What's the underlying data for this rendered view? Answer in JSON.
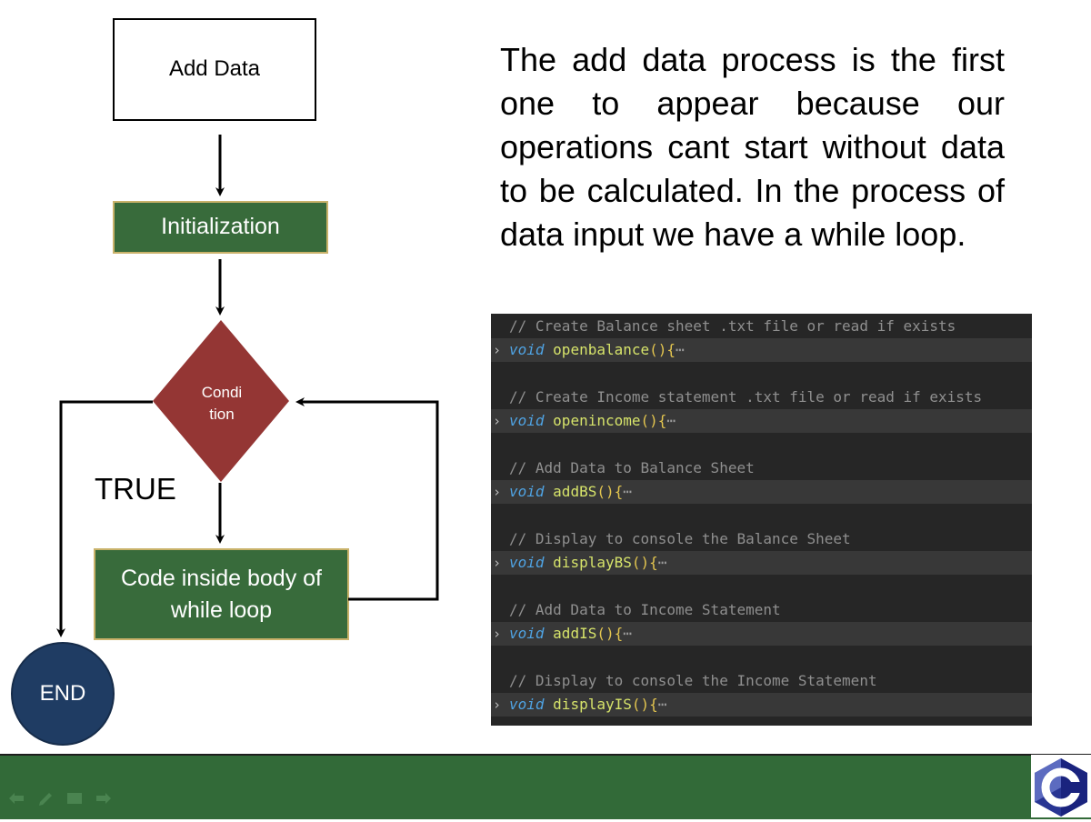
{
  "flowchart": {
    "start_label": "Add Data",
    "init_label": "Initialization",
    "condition_line1": "Condi",
    "condition_line2": "tion",
    "true_label": "TRUE",
    "body_line1": "Code inside body of",
    "body_line2": "while loop",
    "end_label": "END",
    "colors": {
      "init_fill": "#386b3b",
      "condition_fill": "#943634",
      "body_fill": "#386b3b",
      "end_fill": "#1f3c63"
    }
  },
  "description": "The add data process is the first one to appear because our operations cant start without data to be calculated. In the process of data input we have a while loop.",
  "code": {
    "blocks": [
      {
        "comment": "// Create Balance sheet .txt file or read if exists",
        "keyword": "void",
        "function": "openbalance",
        "parens": "(){",
        "ellipsis": "⋯"
      },
      {
        "comment": "// Create Income statement .txt file or read if exists",
        "keyword": "void",
        "function": "openincome",
        "parens": "(){",
        "ellipsis": "⋯"
      },
      {
        "comment": "// Add Data to Balance Sheet",
        "keyword": "void",
        "function": "addBS",
        "parens": "(){",
        "ellipsis": "⋯"
      },
      {
        "comment": "// Display to console the Balance Sheet",
        "keyword": "void",
        "function": "displayBS",
        "parens": "(){",
        "ellipsis": "⋯"
      },
      {
        "comment": "// Add Data to Income Statement",
        "keyword": "void",
        "function": "addIS",
        "parens": "(){",
        "ellipsis": "⋯"
      },
      {
        "comment": "// Display to console the Income Statement",
        "keyword": "void",
        "function": "displayIS",
        "parens": "(){",
        "ellipsis": "⋯"
      }
    ]
  },
  "bottom_bar": {
    "color": "#326a38",
    "nav_icons": [
      "arrow-left-icon",
      "pen-icon",
      "menu-icon",
      "arrow-right-icon"
    ],
    "logo": "c-language-logo-icon"
  }
}
